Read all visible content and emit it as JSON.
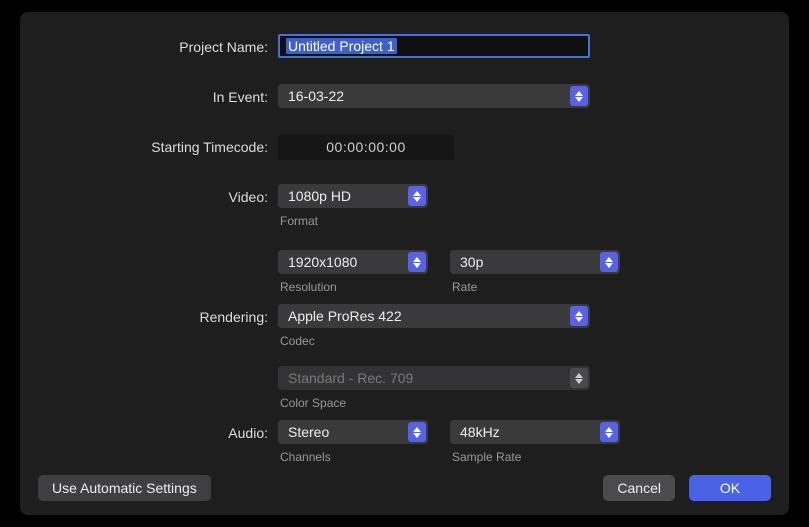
{
  "labels": {
    "project_name": "Project Name:",
    "in_event": "In Event:",
    "starting_tc": "Starting Timecode:",
    "video": "Video:",
    "rendering": "Rendering:",
    "audio": "Audio:"
  },
  "sub": {
    "format": "Format",
    "resolution": "Resolution",
    "rate": "Rate",
    "codec": "Codec",
    "color_space": "Color Space",
    "channels": "Channels",
    "sample_rate": "Sample Rate"
  },
  "values": {
    "project_name": "Untitled Project 1",
    "event": "16-03-22",
    "timecode": "00:00:00:00",
    "video_format": "1080p HD",
    "resolution": "1920x1080",
    "rate": "30p",
    "codec": "Apple ProRes 422",
    "color_space": "Standard - Rec. 709",
    "channels": "Stereo",
    "sample_rate": "48kHz"
  },
  "buttons": {
    "automatic": "Use Automatic Settings",
    "cancel": "Cancel",
    "ok": "OK"
  }
}
